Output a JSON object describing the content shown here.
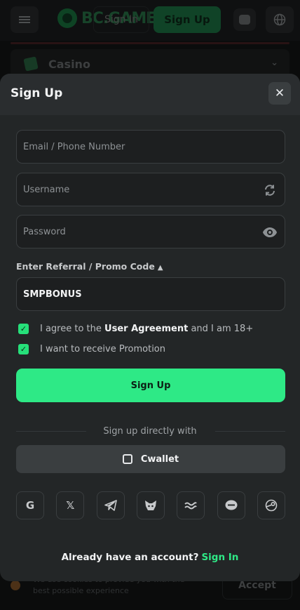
{
  "background": {
    "logo_text": "BC.GAME",
    "sign_in_label": "Sign In",
    "sign_up_label": "Sign Up",
    "casino_label": "Casino",
    "cookie_text": "We use cookies to provide you with the best possible experience",
    "cookie_accept_label": "Accept"
  },
  "modal": {
    "title": "Sign Up",
    "close_icon": "close-icon",
    "email_placeholder": "Email / Phone Number",
    "username_placeholder": "Username",
    "password_placeholder": "Password",
    "promo_toggle_label": "Enter Referral / Promo Code",
    "promo_value": "SMPBONUS",
    "agree_prefix": "I agree to the",
    "agree_link": "User Agreement",
    "agree_suffix": "and I am 18+",
    "promotion_label": "I want to receive Promotion",
    "agree_checked": true,
    "promotion_checked": true,
    "signup_button": "Sign Up",
    "divider_text": "Sign up directly with",
    "cwallet_label": "Cwallet",
    "socials": [
      "google-icon",
      "x-icon",
      "telegram-icon",
      "metamask-icon",
      "wave-icon",
      "line-icon",
      "steam-icon"
    ],
    "have_account_text": "Already have an account?",
    "sign_in_link": "Sign In",
    "colors": {
      "accent": "#2ee986",
      "modal_bg": "#232627",
      "header_bg": "#2a2d2f"
    }
  }
}
